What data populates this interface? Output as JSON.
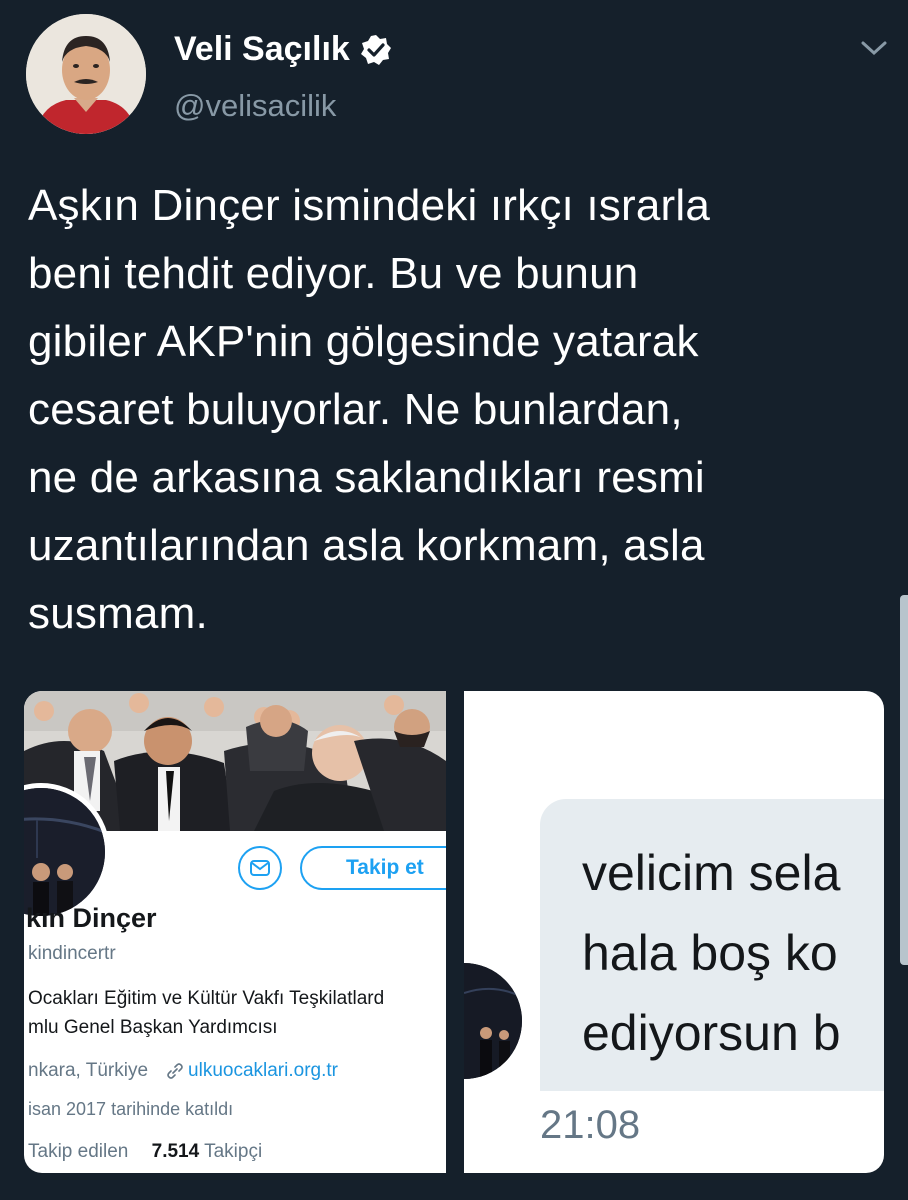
{
  "tweet": {
    "display_name": "Veli Saçılık",
    "handle": "@velisacilik",
    "verified": true,
    "text_lines": [
      "Aşkın Dinçer ismindeki ırkçı ısrarla",
      "beni tehdit ediyor. Bu ve bunun",
      "gibiler AKP'nin gölgesinde yatarak",
      "cesaret buluyorlar. Ne bunlardan,",
      "ne de arkasına saklandıkları resmi",
      "uzantılarından asla korkmam, asla",
      "susmam."
    ]
  },
  "profile_card": {
    "follow_label": "Takip et",
    "name": "kın Dinçer",
    "handle": "kindincertr",
    "bio_lines": [
      "Ocakları Eğitim ve Kültür Vakfı Teşkilatlard",
      "mlu Genel Başkan Yardımcısı"
    ],
    "location": "nkara, Türkiye",
    "link": "ulkuocaklari.org.tr",
    "joined": "isan 2017 tarihinde katıldı",
    "following_label": "Takip edilen",
    "followers_count": "7.514",
    "followers_label": "Takipçi"
  },
  "message": {
    "lines": [
      "velicim sela",
      "hala boş ko",
      "ediyorsun b"
    ],
    "time": "21:08"
  },
  "colors": {
    "background": "#15202b",
    "accent": "#1da1f2",
    "muted": "#8899a6"
  },
  "icons": [
    "verified-badge-icon",
    "chevron-down-icon",
    "mail-icon",
    "link-icon"
  ]
}
